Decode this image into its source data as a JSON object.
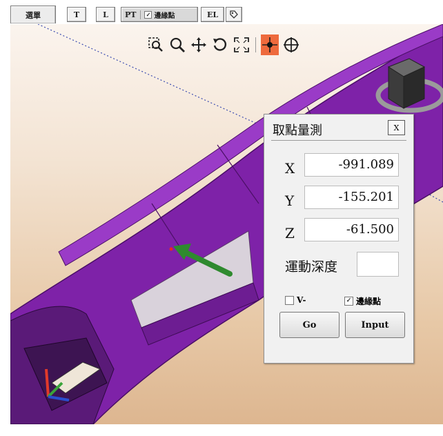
{
  "tabs": {
    "menu": "選單",
    "t": "T",
    "l": "L",
    "pt": "PT",
    "edge_point": "邊緣點",
    "el": "EL"
  },
  "toolbar": {
    "icons": [
      "zoom-window-icon",
      "zoom-icon",
      "pan-icon",
      "rotate-icon",
      "fit-view-icon",
      "point-probe-icon",
      "crosshair-icon"
    ],
    "active_icon": "point-probe-icon"
  },
  "dialog": {
    "title": "取點量測",
    "close_label": "X",
    "x_label": "X",
    "x_value": "-991.089",
    "y_label": "Y",
    "y_value": "-155.201",
    "z_label": "Z",
    "z_value": "-61.500",
    "depth_label": "運動深度",
    "depth_value": "",
    "v_minus_label": "V-",
    "v_minus_checked": false,
    "edge_point_label": "邊緣點",
    "edge_point_checked": true,
    "go_label": "Go",
    "input_label": "Input"
  },
  "colors": {
    "part": "#7a1fa0",
    "active_tool": "#ee6a3d",
    "arrow": "#2f8a2f"
  }
}
